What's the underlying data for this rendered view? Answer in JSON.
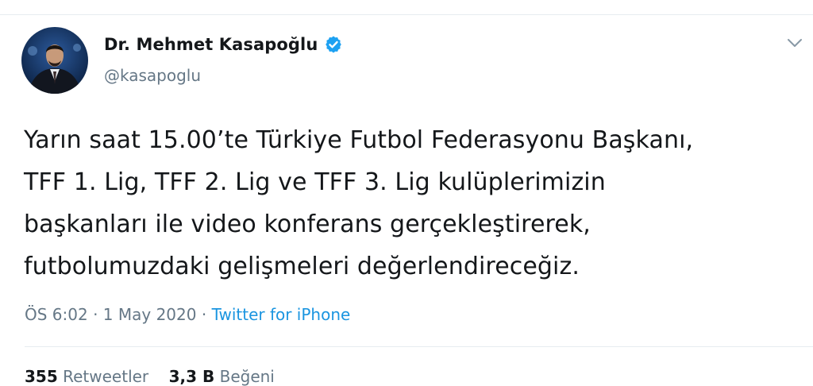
{
  "user": {
    "display_name": "Dr. Mehmet Kasapoğlu",
    "handle": "@kasapoglu",
    "verified": true
  },
  "tweet": {
    "text": "Yarın saat 15.00’te Türkiye Futbol Federasyonu Başkanı,\nTFF 1. Lig, TFF 2. Lig ve TFF 3. Lig kulüplerimizin\nbaşkanları ile video konferans gerçekleştirerek,\nfutbolumuzdaki gelişmeleri değerlendireceğiz."
  },
  "meta": {
    "time": "ÖS 6:02",
    "sep1": " · ",
    "date": "1 May 2020",
    "sep2": " · ",
    "source": "Twitter for iPhone"
  },
  "stats": {
    "retweets_count": "355",
    "retweets_label": "Retweetler",
    "likes_count": "3,3 B",
    "likes_label": "Beğeni"
  },
  "icons": {
    "verified_badge": "verified-badge-icon",
    "more_menu": "chevron-down-icon"
  },
  "colors": {
    "link": "#1b95e0",
    "secondary_text": "#657786",
    "primary_text": "#14171a",
    "verified": "#1da1f2"
  }
}
